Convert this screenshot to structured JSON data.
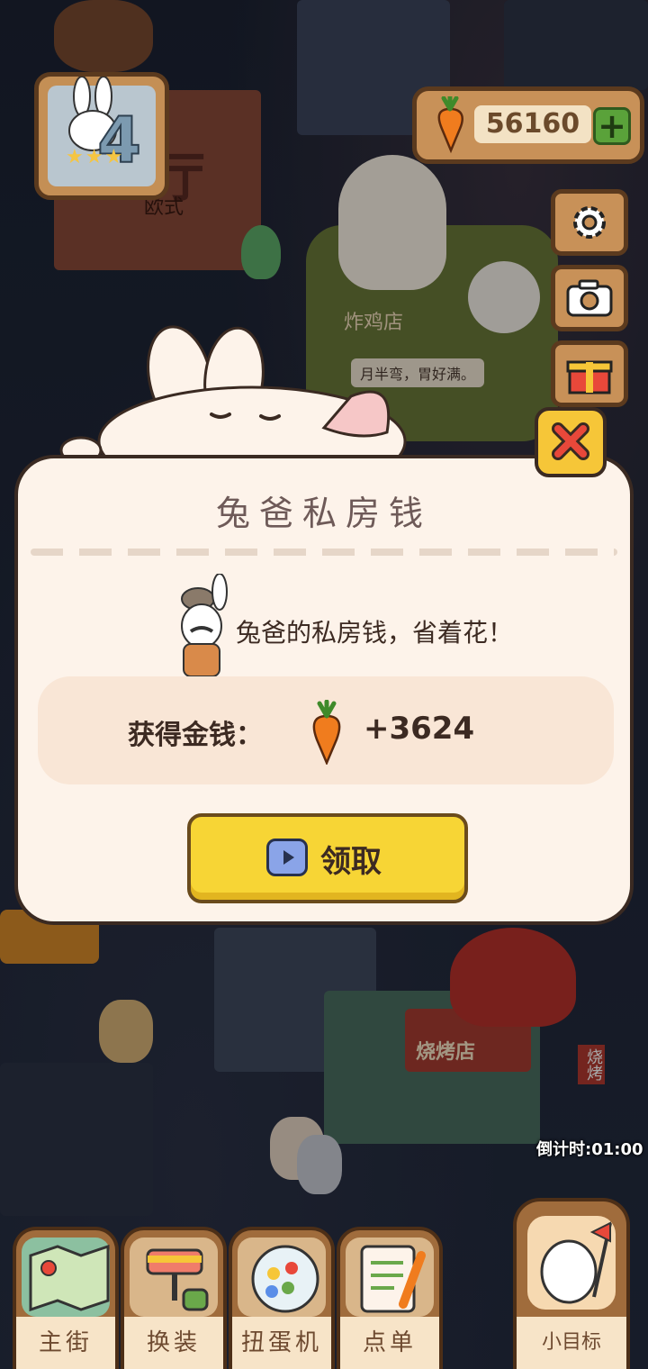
{
  "level": {
    "number": "4",
    "stars": "★★★"
  },
  "currency": {
    "amount": "56160",
    "plus_label": "+"
  },
  "side_buttons": [
    "settings-icon",
    "camera-icon",
    "gift-icon"
  ],
  "scene": {
    "fried_chicken_sign": "炸鸡店",
    "chicken_slogan": "月半弯，胃好满。",
    "bbq_sign": "烧烤店",
    "bbq_side_sign": "烧烤",
    "restaurant_partial": "厅",
    "restaurant_partial2": "欧式"
  },
  "dialog": {
    "title": "兔爸私房钱",
    "description": "兔爸的私房钱，省着花！",
    "reward_label": "获得金钱：",
    "reward_value": "+3624",
    "claim_label": "领取"
  },
  "countdown": "倒计时:01:00",
  "nav": [
    {
      "label": "主街",
      "icon": "map-icon"
    },
    {
      "label": "换装",
      "icon": "paint-roller-icon"
    },
    {
      "label": "扭蛋机",
      "icon": "gacha-icon"
    },
    {
      "label": "点单",
      "icon": "order-list-icon"
    }
  ],
  "goal": {
    "label": "小目标",
    "icon": "flag-paw-icon"
  },
  "colors": {
    "accent_yellow": "#f7d535",
    "wood": "#c89158",
    "dialog_bg": "#fdf3ea"
  }
}
